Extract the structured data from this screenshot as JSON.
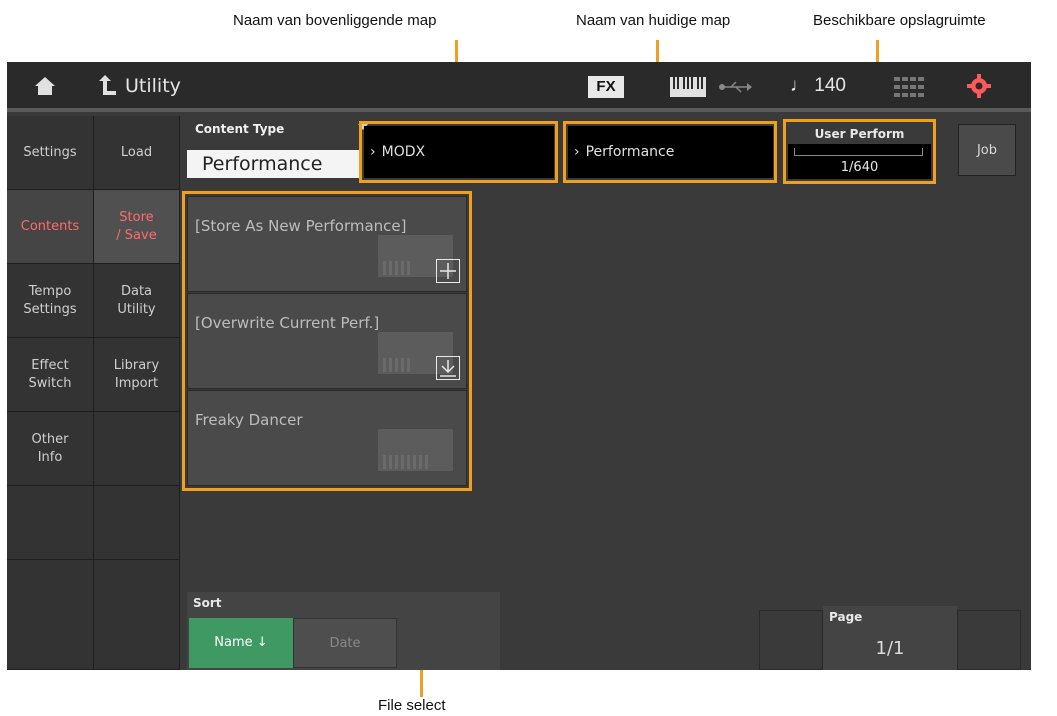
{
  "callouts": {
    "parent_folder": "Naam van bovenliggende map",
    "current_folder": "Naam van huidige map",
    "storage": "Beschikbare opslagruimte",
    "file_select": "File select"
  },
  "topbar": {
    "title": "Utility",
    "fx": "FX",
    "tempo": "♩ 140"
  },
  "menu": {
    "col1": [
      "Settings",
      "Contents",
      "Tempo\nSettings",
      "Effect\nSwitch",
      "Other\nInfo",
      "",
      ""
    ],
    "col2": [
      "Load",
      "Store\n/ Save",
      "Data\nUtility",
      "Library\nImport",
      "",
      "",
      ""
    ]
  },
  "content_type": {
    "label": "Content Type",
    "value": "Performance"
  },
  "path": {
    "parent": "MODX",
    "current": "Performance"
  },
  "storage": {
    "label": "User Perform",
    "value": "1/640",
    "fill_fraction": 0.0016
  },
  "job_label": "Job",
  "files": [
    {
      "name": "[Store As New Performance]",
      "action": "plus-icon"
    },
    {
      "name": "[Overwrite Current Perf.]",
      "action": "download-icon"
    },
    {
      "name": "Freaky Dancer",
      "action": ""
    }
  ],
  "sort": {
    "label": "Sort",
    "name": "Name ↓",
    "date": "Date"
  },
  "page": {
    "label": "Page",
    "value": "1/1"
  },
  "colors": {
    "highlight": "#f0a020",
    "active_menu": "#ff6b6b",
    "sort_active": "#3e9a62"
  }
}
